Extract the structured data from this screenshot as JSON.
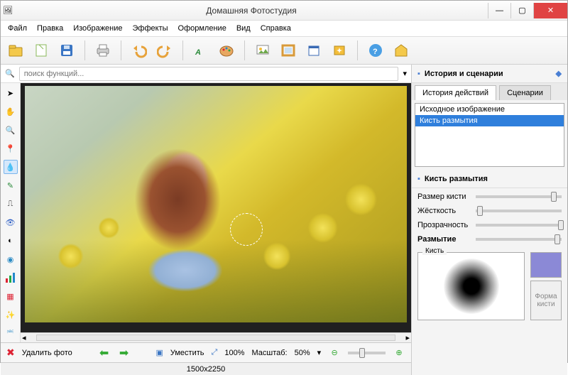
{
  "title": "Домашняя Фотостудия",
  "menu": [
    "Файл",
    "Правка",
    "Изображение",
    "Эффекты",
    "Оформление",
    "Вид",
    "Справка"
  ],
  "search": {
    "placeholder": "поиск функций..."
  },
  "right": {
    "header": "История и сценарии",
    "tabs": [
      "История действий",
      "Сценарии"
    ],
    "history": [
      "Исходное изображение",
      "Кисть размытия"
    ],
    "tool_header": "Кисть размытия",
    "sliders": [
      {
        "label": "Размер кисти",
        "pos": 88
      },
      {
        "label": "Жёсткость",
        "pos": 2
      },
      {
        "label": "Прозрачность",
        "pos": 96
      },
      {
        "label": "Размытие",
        "pos": 92,
        "bold": true
      }
    ],
    "brush_label": "Кисть",
    "shape_btn": "Форма кисти"
  },
  "bottom": {
    "delete": "Удалить фото",
    "fit": "Уместить",
    "pct": "100%",
    "scale_lbl": "Масштаб:",
    "scale_val": "50%"
  },
  "status": "1500x2250",
  "toolbar_icons": [
    "folder",
    "new",
    "save",
    "print",
    "undo",
    "redo",
    "text",
    "palette",
    "crop",
    "image",
    "frame",
    "noise",
    "help",
    "star"
  ],
  "left_tools": [
    "cursor",
    "hand",
    "zoom",
    "pin",
    "drop",
    "pencil",
    "stamp",
    "eye",
    "contrast",
    "swirl",
    "bars",
    "layers",
    "fx",
    "crop2"
  ]
}
